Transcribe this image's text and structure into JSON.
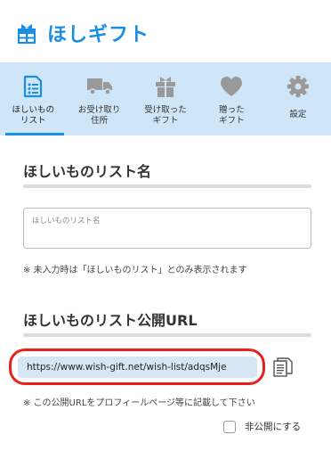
{
  "app": {
    "title": "ほしギフト",
    "accent": "#1a8ee3"
  },
  "nav": {
    "items": [
      {
        "label": "ほしいもの\nリスト",
        "icon": "list-document-icon",
        "active": true
      },
      {
        "label": "お受け取り\n住所",
        "icon": "delivery-truck-icon"
      },
      {
        "label": "受け取った\nギフト",
        "icon": "gift-box-icon"
      },
      {
        "label": "贈った\nギフト",
        "icon": "heart-icon"
      },
      {
        "label": "設定",
        "icon": "gear-icon"
      }
    ]
  },
  "list_name": {
    "title": "ほしいものリスト名",
    "placeholder": "ほしいものリスト名",
    "note": "※ 未入力時は「ほしいものリスト」とのみ表示されます"
  },
  "public_url": {
    "title": "ほしいものリスト公開URL",
    "url": "https://www.wish-gift.net/wish-list/adqsMje",
    "note": "※ この公開URLをプロフィールページ等に記載して下さい",
    "highlight_color": "#e8221b"
  },
  "private": {
    "label": "非公開にする",
    "checked": false
  }
}
